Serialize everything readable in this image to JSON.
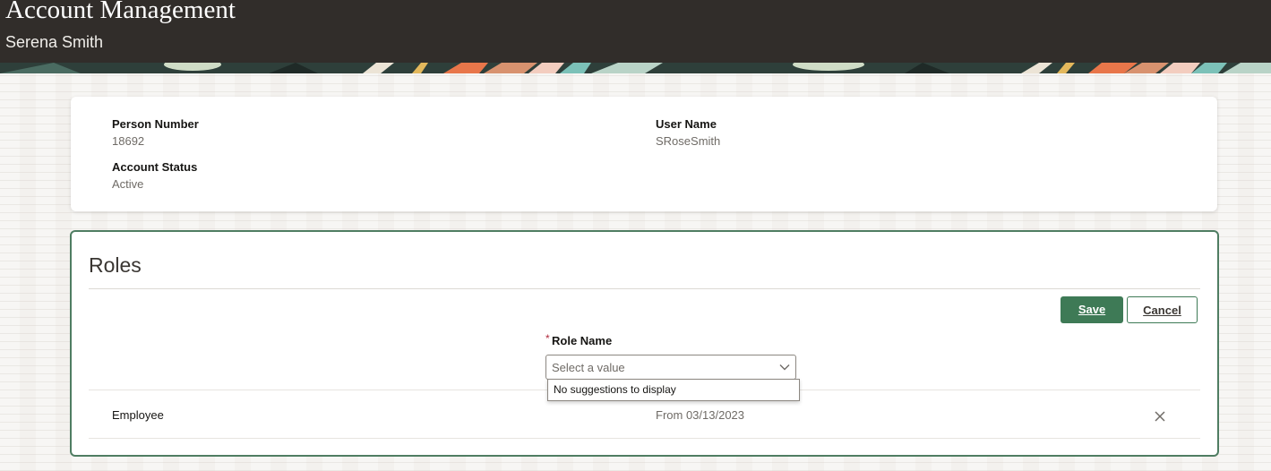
{
  "header": {
    "title": "Account Management",
    "subtitle": "Serena Smith"
  },
  "account_info": {
    "person_number_label": "Person Number",
    "person_number_value": "18692",
    "user_name_label": "User Name",
    "user_name_value": "SRoseSmith",
    "account_status_label": "Account Status",
    "account_status_value": "Active"
  },
  "roles": {
    "title": "Roles",
    "save_label": "Save",
    "cancel_label": "Cancel",
    "required_marker": "*",
    "role_name_label": "Role Name",
    "role_name_placeholder": "Select a value",
    "dropdown_message": "No suggestions to display",
    "rows": [
      {
        "name": "Employee",
        "date": "From 03/13/2023"
      }
    ]
  },
  "colors": {
    "header_bg": "#312d2a",
    "accent_green": "#3e7a56",
    "required_red": "#b0293c",
    "page_bg": "#f3f1ee"
  },
  "icons": {
    "select_chevron": "chevron-down-icon",
    "row_remove": "close-icon"
  }
}
